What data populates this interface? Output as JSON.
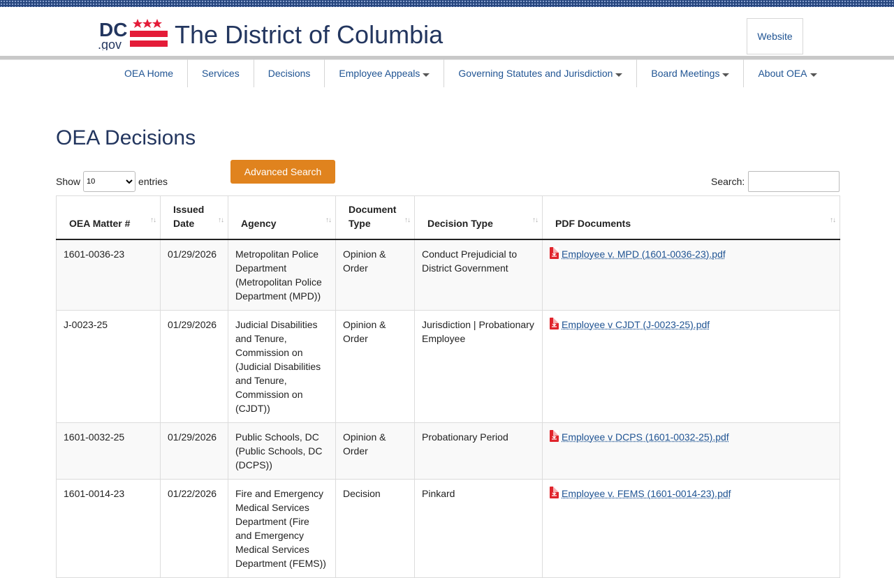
{
  "header": {
    "logo_text_dc": "DC",
    "logo_text_gov": ".gov",
    "site_title": "The District of Columbia",
    "website_button": "Website"
  },
  "nav": {
    "items": [
      {
        "label": "OEA Home",
        "dropdown": false
      },
      {
        "label": "Services",
        "dropdown": false
      },
      {
        "label": "Decisions",
        "dropdown": false
      },
      {
        "label": "Employee Appeals",
        "dropdown": true
      },
      {
        "label": "Governing Statutes and Jurisdiction",
        "dropdown": true
      },
      {
        "label": "Board Meetings",
        "dropdown": true
      },
      {
        "label": "About OEA",
        "dropdown": true
      }
    ]
  },
  "main": {
    "page_title": "OEA Decisions",
    "show_label": "Show",
    "entries_label": "entries",
    "page_size_selected": "10",
    "advanced_search_label": "Advanced Search",
    "search_label": "Search:",
    "search_value": ""
  },
  "table": {
    "columns": [
      "OEA Matter #",
      "Issued Date",
      "Agency",
      "Document Type",
      "Decision Type",
      "PDF Documents"
    ],
    "rows": [
      {
        "matter": "1601-0036-23",
        "issued": "01/29/2026",
        "agency": "Metropolitan Police Department (Metropolitan Police Department (MPD))",
        "doc_type": "Opinion & Order",
        "decision_type": "Conduct Prejudicial to District Government",
        "pdf": "Employee v. MPD (1601-0036-23).pdf"
      },
      {
        "matter": "J-0023-25",
        "issued": "01/29/2026",
        "agency": "Judicial Disabilities and Tenure, Commission on (Judicial Disabilities and Tenure, Commission on (CJDT))",
        "doc_type": "Opinion & Order",
        "decision_type": "Jurisdiction | Probationary Employee",
        "pdf": "Employee v CJDT (J-0023-25).pdf"
      },
      {
        "matter": "1601-0032-25",
        "issued": "01/29/2026",
        "agency": "Public Schools, DC (Public Schools, DC (DCPS))",
        "doc_type": "Opinion & Order",
        "decision_type": "Probationary Period",
        "pdf": "Employee v DCPS (1601-0032-25).pdf"
      },
      {
        "matter": "1601-0014-23",
        "issued": "01/22/2026",
        "agency": "Fire and Emergency Medical Services Department (Fire and Emergency Medical Services Department (FEMS))",
        "doc_type": "Decision",
        "decision_type": "Pinkard",
        "pdf": "Employee v. FEMS (1601-0014-23).pdf"
      }
    ]
  },
  "colors": {
    "brand_navy": "#23365f",
    "link_blue": "#205493",
    "dc_red": "#e41c38",
    "button_orange": "#e0831e",
    "pdf_red": "#e0242c"
  },
  "icons": [
    "dc-flag-logo",
    "caret-down-icon",
    "sort-icon",
    "pdf-file-icon"
  ]
}
